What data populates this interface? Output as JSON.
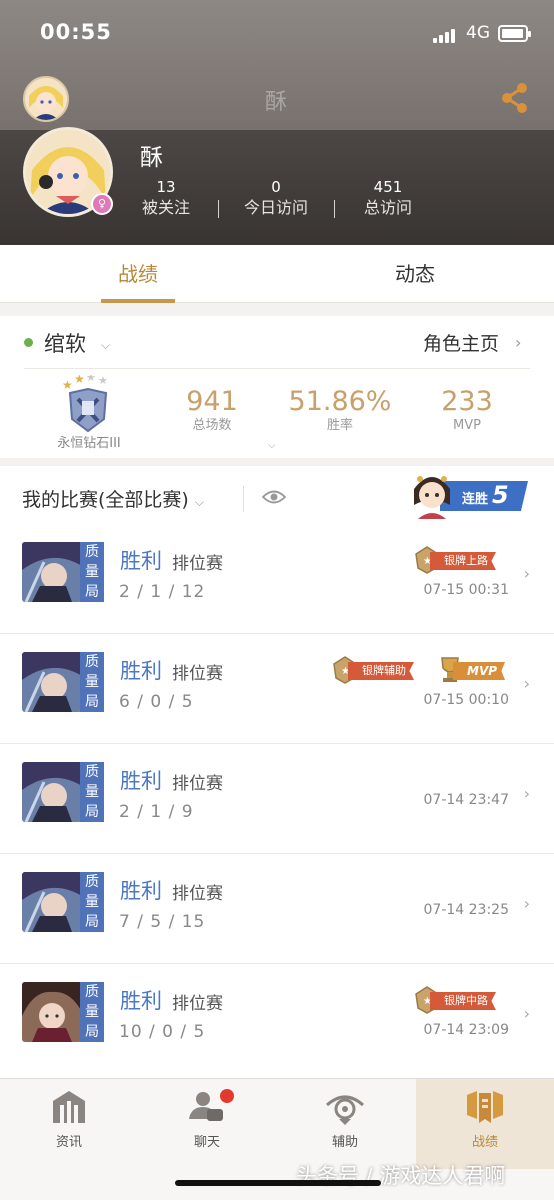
{
  "status_bar": {
    "time": "00:55",
    "network": "4G"
  },
  "header": {
    "nav_title": "酥",
    "name": "酥",
    "stats": [
      {
        "value": "13",
        "label": "被关注"
      },
      {
        "value": "0",
        "label": "今日访问"
      },
      {
        "value": "451",
        "label": "总访问"
      }
    ]
  },
  "tabs": [
    {
      "label": "战绩",
      "active": true
    },
    {
      "label": "动态",
      "active": false
    }
  ],
  "role": {
    "name": "绾软",
    "home_label": "角色主页",
    "rank": "永恒钻石III",
    "stats": [
      {
        "value": "941",
        "label": "总场数"
      },
      {
        "value": "51.86%",
        "label": "胜率"
      },
      {
        "value": "233",
        "label": "MVP"
      }
    ]
  },
  "matches": {
    "title": "我的比赛(全部比赛)",
    "streak_label": "连胜",
    "streak_count": "5",
    "rows": [
      {
        "tag": "质量局",
        "result": "胜利",
        "mode": "排位赛",
        "kda": "2 / 1 / 12",
        "time": "07-15 00:31",
        "badges": [
          "银牌上路"
        ]
      },
      {
        "tag": "质量局",
        "result": "胜利",
        "mode": "排位赛",
        "kda": "6 / 0 / 5",
        "time": "07-15 00:10",
        "badges": [
          "银牌辅助",
          "MVP"
        ]
      },
      {
        "tag": "质量局",
        "result": "胜利",
        "mode": "排位赛",
        "kda": "2 / 1 / 9",
        "time": "07-14 23:47",
        "badges": []
      },
      {
        "tag": "质量局",
        "result": "胜利",
        "mode": "排位赛",
        "kda": "7 / 5 / 15",
        "time": "07-14 23:25",
        "badges": []
      },
      {
        "tag": "质量局",
        "result": "胜利",
        "mode": "排位赛",
        "kda": "10 / 0 / 5",
        "time": "07-14 23:09",
        "badges": [
          "银牌中路"
        ]
      }
    ]
  },
  "bottom_nav": [
    {
      "label": "资讯",
      "icon": "news-icon"
    },
    {
      "label": "聊天",
      "icon": "chat-icon"
    },
    {
      "label": "辅助",
      "icon": "assist-icon"
    },
    {
      "label": "战绩",
      "icon": "record-icon",
      "active": true
    }
  ],
  "watermark": "头条号 / 游戏达人君啊",
  "colors": {
    "accent": "#c8974a",
    "win": "#4b78c4",
    "tag": "#4f72b8",
    "streak": "#3d6fc4"
  }
}
